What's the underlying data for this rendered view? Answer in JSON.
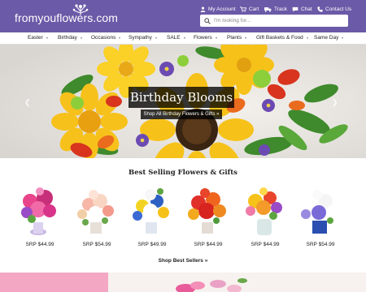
{
  "header": {
    "logo_text": "fromyouflowers",
    "logo_suffix": ".com",
    "utility": {
      "account": "My Account",
      "cart": "Cart",
      "track": "Track",
      "chat": "Chat",
      "contact": "Contact Us"
    },
    "search": {
      "placeholder": "I'm looking for..."
    },
    "brand_color": "#6a5aa7"
  },
  "nav": {
    "items": [
      {
        "label": "Easter",
        "dropdown": true
      },
      {
        "label": "Birthday",
        "dropdown": true
      },
      {
        "label": "Occasions",
        "dropdown": true
      },
      {
        "label": "Sympathy",
        "dropdown": true
      },
      {
        "label": "SALE",
        "dropdown": true
      },
      {
        "label": "Flowers",
        "dropdown": true
      },
      {
        "label": "Plants",
        "dropdown": true
      },
      {
        "label": "Gift Baskets & Food",
        "dropdown": true
      },
      {
        "label": "Same Day",
        "dropdown": true
      }
    ]
  },
  "hero": {
    "title": "Birthday Blooms",
    "button": "Shop All Birthday Flowers & Gifts »",
    "prev_icon": "chevron-left-icon",
    "next_icon": "chevron-right-icon"
  },
  "best_sellers": {
    "title": "Best Selling Flowers & Gifts",
    "products": [
      {
        "price": "SRP $44.99"
      },
      {
        "price": "SRP $54.99"
      },
      {
        "price": "SRP $49.99"
      },
      {
        "price": "SRP $44.99"
      },
      {
        "price": "SRP $44.99"
      },
      {
        "price": "SRP $54.99"
      }
    ],
    "shop_link": "Shop Best Sellers »"
  }
}
